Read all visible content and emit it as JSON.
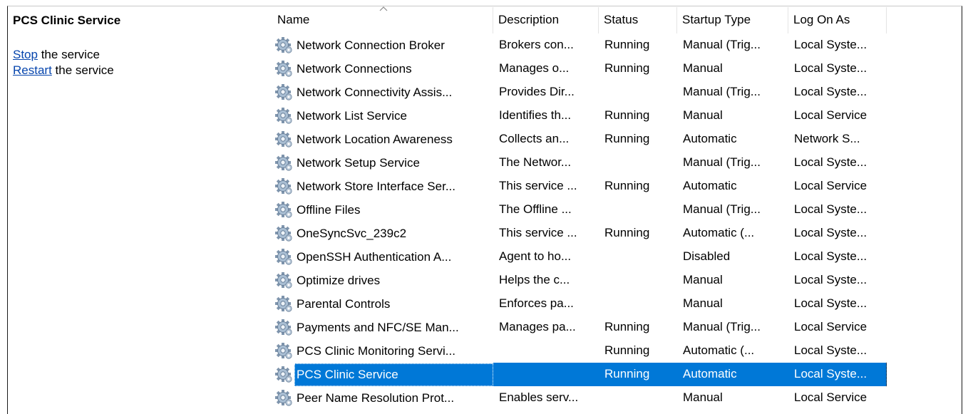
{
  "left_pane": {
    "title": "PCS Clinic Service",
    "actions": [
      {
        "link": "Stop",
        "rest": " the service"
      },
      {
        "link": "Restart",
        "rest": " the service"
      }
    ]
  },
  "table": {
    "headers": {
      "name": "Name",
      "description": "Description",
      "status": "Status",
      "startup": "Startup Type",
      "logon": "Log On As"
    },
    "rows": [
      {
        "name": "Network Connection Broker",
        "description": "Brokers con...",
        "status": "Running",
        "startup": "Manual (Trig...",
        "logon": "Local Syste..."
      },
      {
        "name": "Network Connections",
        "description": "Manages o...",
        "status": "Running",
        "startup": "Manual",
        "logon": "Local Syste..."
      },
      {
        "name": "Network Connectivity Assis...",
        "description": "Provides Dir...",
        "status": "",
        "startup": "Manual (Trig...",
        "logon": "Local Syste..."
      },
      {
        "name": "Network List Service",
        "description": "Identifies th...",
        "status": "Running",
        "startup": "Manual",
        "logon": "Local Service"
      },
      {
        "name": "Network Location Awareness",
        "description": "Collects an...",
        "status": "Running",
        "startup": "Automatic",
        "logon": "Network S..."
      },
      {
        "name": "Network Setup Service",
        "description": "The Networ...",
        "status": "",
        "startup": "Manual (Trig...",
        "logon": "Local Syste..."
      },
      {
        "name": "Network Store Interface Ser...",
        "description": "This service ...",
        "status": "Running",
        "startup": "Automatic",
        "logon": "Local Service"
      },
      {
        "name": "Offline Files",
        "description": "The Offline ...",
        "status": "",
        "startup": "Manual (Trig...",
        "logon": "Local Syste..."
      },
      {
        "name": "OneSyncSvc_239c2",
        "description": "This service ...",
        "status": "Running",
        "startup": "Automatic (...",
        "logon": "Local Syste..."
      },
      {
        "name": "OpenSSH Authentication A...",
        "description": "Agent to ho...",
        "status": "",
        "startup": "Disabled",
        "logon": "Local Syste..."
      },
      {
        "name": "Optimize drives",
        "description": "Helps the c...",
        "status": "",
        "startup": "Manual",
        "logon": "Local Syste..."
      },
      {
        "name": "Parental Controls",
        "description": "Enforces pa...",
        "status": "",
        "startup": "Manual",
        "logon": "Local Syste..."
      },
      {
        "name": "Payments and NFC/SE Man...",
        "description": "Manages pa...",
        "status": "Running",
        "startup": "Manual (Trig...",
        "logon": "Local Service"
      },
      {
        "name": "PCS Clinic Monitoring Servi...",
        "description": "",
        "status": "Running",
        "startup": "Automatic (...",
        "logon": "Local Syste..."
      },
      {
        "name": "PCS Clinic Service",
        "description": "",
        "status": "Running",
        "startup": "Automatic",
        "logon": "Local Syste...",
        "selected": true
      },
      {
        "name": "Peer Name Resolution Prot...",
        "description": "Enables serv...",
        "status": "",
        "startup": "Manual",
        "logon": "Local Service"
      }
    ]
  },
  "icons": {
    "row_icon": "gear-icon",
    "sort_icon": "sort-ascending-caret-icon"
  },
  "colors": {
    "selection": "#0078d7",
    "link": "#0645ad"
  }
}
